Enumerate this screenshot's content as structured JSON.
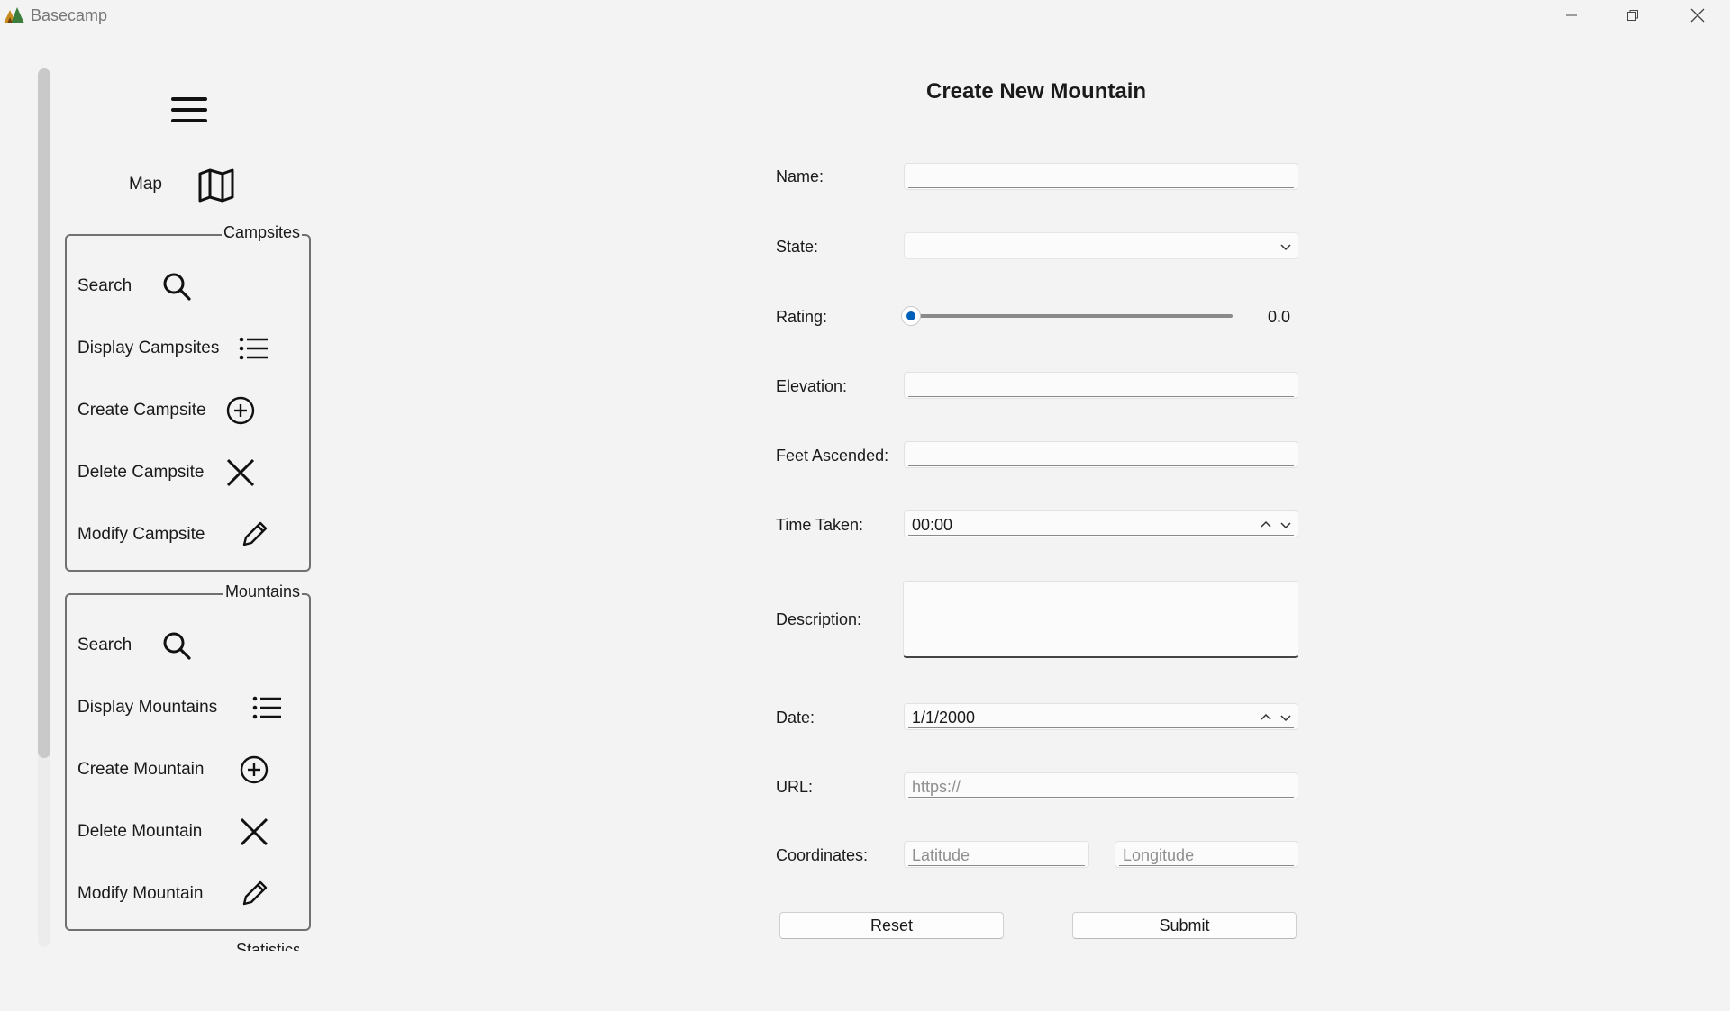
{
  "window": {
    "title": "Basecamp",
    "controls": [
      "minimize-icon",
      "maximize-icon",
      "close-icon"
    ]
  },
  "sidebar": {
    "menu_icon": "hamburger-icon",
    "map": {
      "label": "Map",
      "icon": "map-icon"
    },
    "groups": [
      {
        "title": "Campsites",
        "items": [
          {
            "label": "Search",
            "icon": "search-icon"
          },
          {
            "label": "Display Campsites",
            "icon": "list-icon"
          },
          {
            "label": "Create Campsite",
            "icon": "add-circle-icon"
          },
          {
            "label": "Delete Campsite",
            "icon": "close-icon"
          },
          {
            "label": "Modify Campsite",
            "icon": "pencil-icon"
          }
        ]
      },
      {
        "title": "Mountains",
        "items": [
          {
            "label": "Search",
            "icon": "search-icon"
          },
          {
            "label": "Display Mountains",
            "icon": "list-icon"
          },
          {
            "label": "Create Mountain",
            "icon": "add-circle-icon"
          },
          {
            "label": "Delete Mountain",
            "icon": "close-icon"
          },
          {
            "label": "Modify Mountain",
            "icon": "pencil-icon"
          }
        ]
      }
    ],
    "next_group_peek": "Statistics"
  },
  "form": {
    "title": "Create New Mountain",
    "name": {
      "label": "Name:",
      "value": ""
    },
    "state": {
      "label": "State:",
      "value": ""
    },
    "rating": {
      "label": "Rating:",
      "value": 0.0,
      "display": "0.0"
    },
    "elevation": {
      "label": "Elevation:",
      "value": ""
    },
    "feet_ascended": {
      "label": "Feet Ascended:",
      "value": ""
    },
    "time_taken": {
      "label": "Time Taken:",
      "value": "00:00"
    },
    "description": {
      "label": "Description:",
      "value": ""
    },
    "date": {
      "label": "Date:",
      "value": "1/1/2000"
    },
    "url": {
      "label": "URL:",
      "placeholder": "https://"
    },
    "coordinates": {
      "label": "Coordinates:",
      "latitude_placeholder": "Latitude",
      "longitude_placeholder": "Longitude"
    },
    "reset_label": "Reset",
    "submit_label": "Submit"
  },
  "colors": {
    "accent": "#005fb8",
    "background": "#f3f3f3",
    "border": "#707070"
  }
}
